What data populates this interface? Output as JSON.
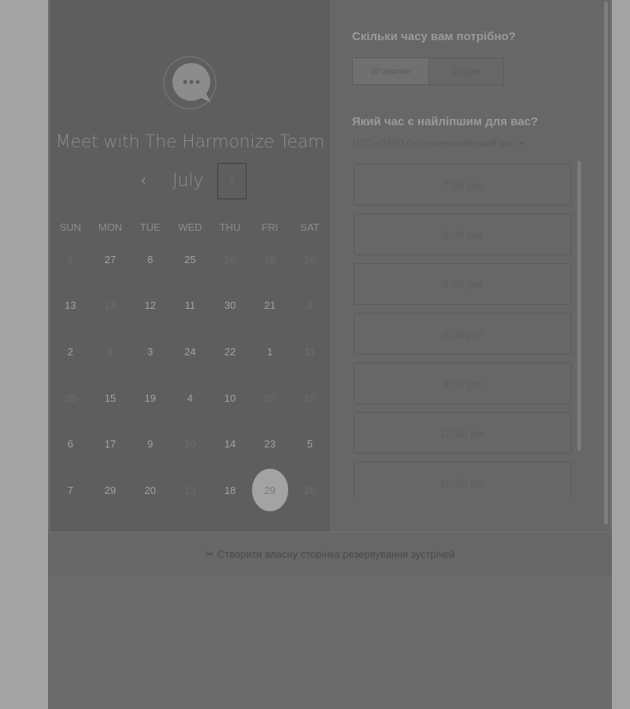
{
  "booking": {
    "title": "Meet with The Harmonize Team",
    "month": "July",
    "nav_prev": "‹",
    "nav_next": "›",
    "logo_icon": "chat-bubble-icon"
  },
  "calendar": {
    "weekdays": [
      "SUN",
      "MON",
      "TUE",
      "WED",
      "THU",
      "FRI",
      "SAT"
    ],
    "weeks": [
      [
        {
          "d": "1",
          "dim": true
        },
        {
          "d": "27"
        },
        {
          "d": "8"
        },
        {
          "d": "25"
        },
        {
          "d": "26",
          "dim": true
        },
        {
          "d": "18",
          "dim": true
        },
        {
          "d": "16",
          "dim": true
        }
      ],
      [
        {
          "d": "13"
        },
        {
          "d": "13",
          "dim": true
        },
        {
          "d": "12"
        },
        {
          "d": "11"
        },
        {
          "d": "30"
        },
        {
          "d": "21"
        },
        {
          "d": "3",
          "dim": true
        }
      ],
      [
        {
          "d": "2"
        },
        {
          "d": "6",
          "dim": true
        },
        {
          "d": "3"
        },
        {
          "d": "24"
        },
        {
          "d": "22"
        },
        {
          "d": "1"
        },
        {
          "d": "11",
          "dim": true
        }
      ],
      [
        {
          "d": "28",
          "dim": true
        },
        {
          "d": "15"
        },
        {
          "d": "19"
        },
        {
          "d": "4"
        },
        {
          "d": "10"
        },
        {
          "d": "25",
          "dim": true
        },
        {
          "d": "15",
          "dim": true
        }
      ],
      [
        {
          "d": "6"
        },
        {
          "d": "17"
        },
        {
          "d": "9"
        },
        {
          "d": "10",
          "dim": true
        },
        {
          "d": "14"
        },
        {
          "d": "23"
        },
        {
          "d": "5"
        }
      ],
      [
        {
          "d": "7"
        },
        {
          "d": "29"
        },
        {
          "d": "20"
        },
        {
          "d": "13",
          "dim": true
        },
        {
          "d": "18"
        },
        {
          "d": "29",
          "selected": true
        },
        {
          "d": "26",
          "dim": true
        }
      ]
    ]
  },
  "scheduler": {
    "duration_question": "Скільки часу вам потрібно?",
    "durations": [
      "30 хвилин",
      "1 годин"
    ],
    "time_question": "Який час є найліпшим для вас?",
    "timezone": "UTC +03:00 Східноєвропейський час",
    "slots": [
      "7:30 pm",
      "8:00 pm",
      "8:30 pm",
      "9:00 pm",
      "9:30 pm",
      "10:00 pm",
      "10:30 pm"
    ]
  },
  "footer": {
    "link_text": "Створити власну сторінка резервування зустрічей",
    "icon": "scissors-icon"
  },
  "colors": {
    "overlay_bg": "#a3a3a3",
    "left_panel": "#5e5e5e",
    "right_panel": "#676767"
  }
}
